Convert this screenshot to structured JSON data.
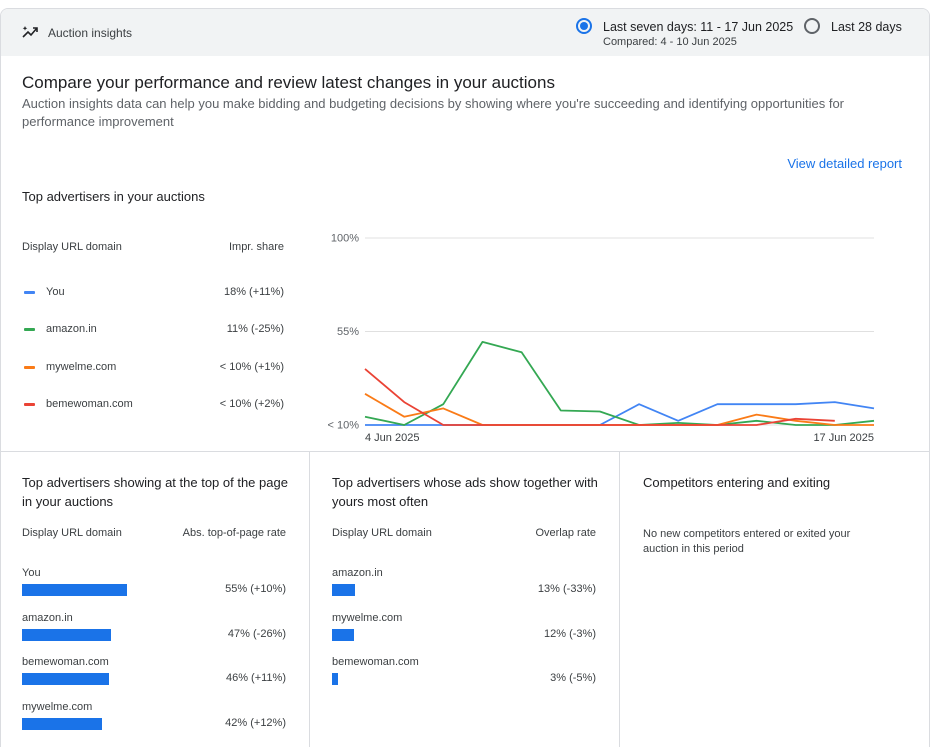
{
  "header": {
    "icon": "trending-up-icon",
    "title": "Auction insights",
    "range_options": [
      {
        "label": "Last seven days: 11 - 17 Jun 2025",
        "sublabel": "Compared: 4 - 10 Jun 2025",
        "selected": true
      },
      {
        "label": "Last 28 days",
        "selected": false
      }
    ]
  },
  "intro": {
    "title": "Compare your performance and review latest changes in your auctions",
    "description": "Auction insights data can help you make bidding and budgeting decisions by showing where you're succeeding and identifying opportunities for performance improvement",
    "view_report": "View detailed report"
  },
  "top_advertisers": {
    "title": "Top advertisers in your auctions",
    "col_domain": "Display URL domain",
    "col_share": "Impr. share",
    "rows": [
      {
        "name": "You",
        "value": "18% (+11%)",
        "color": "#4285f4"
      },
      {
        "name": "amazon.in",
        "value": "11% (-25%)",
        "color": "#34a853"
      },
      {
        "name": "mywelme.com",
        "value": "< 10% (+1%)",
        "color": "#fa7b17"
      },
      {
        "name": "bemewoman.com",
        "value": "< 10% (+2%)",
        "color": "#ea4335"
      }
    ]
  },
  "chart_data": {
    "type": "line",
    "y_tick_labels": [
      "100%",
      "55%",
      "< 10%"
    ],
    "y_ticks": [
      100,
      55,
      10
    ],
    "ylim": [
      10,
      100
    ],
    "x_start_label": "4 Jun 2025",
    "x_end_label": "17 Jun 2025",
    "x": [
      "4 Jun",
      "",
      "",
      "",
      "",
      "",
      "",
      "",
      "",
      "",
      "",
      "",
      "",
      "17 Jun"
    ],
    "grid": true,
    "series": [
      {
        "name": "You",
        "color": "#4285f4",
        "values": [
          10,
          10,
          10,
          10,
          10,
          10,
          10,
          20,
          12,
          20,
          20,
          20,
          21,
          18
        ]
      },
      {
        "name": "amazon.in",
        "color": "#34a853",
        "values": [
          14,
          10,
          20,
          50,
          45,
          17,
          16.5,
          10,
          11,
          10,
          12,
          10,
          10,
          12
        ]
      },
      {
        "name": "mywelme.com",
        "color": "#fa7b17",
        "values": [
          25,
          14,
          18,
          10,
          10,
          10,
          10,
          10,
          10,
          10,
          15,
          12,
          10,
          10
        ]
      },
      {
        "name": "bemewoman.com",
        "color": "#ea4335",
        "values": [
          37,
          21,
          10,
          10,
          10,
          10,
          10,
          10,
          10,
          10,
          10,
          13,
          12,
          null
        ]
      }
    ]
  },
  "top_of_page": {
    "title": "Top advertisers showing at the top of the page in your auctions",
    "col_domain": "Display URL domain",
    "col_rate": "Abs. top-of-page rate",
    "rows": [
      {
        "name": "You",
        "value": "55% (+10%)",
        "fraction": 0.55
      },
      {
        "name": "amazon.in",
        "value": "47% (-26%)",
        "fraction": 0.47
      },
      {
        "name": "bemewoman.com",
        "value": "46% (+11%)",
        "fraction": 0.46
      },
      {
        "name": "mywelme.com",
        "value": "42% (+12%)",
        "fraction": 0.42
      }
    ]
  },
  "overlap": {
    "title": "Top advertisers whose ads show together with yours most often",
    "col_domain": "Display URL domain",
    "col_rate": "Overlap rate",
    "rows": [
      {
        "name": "amazon.in",
        "value": "13% (-33%)",
        "fraction": 0.13
      },
      {
        "name": "mywelme.com",
        "value": "12% (-3%)",
        "fraction": 0.12
      },
      {
        "name": "bemewoman.com",
        "value": "3% (-5%)",
        "fraction": 0.03
      }
    ]
  },
  "competitors": {
    "title": "Competitors entering and exiting",
    "message": "No new competitors entered or exited your auction in this period"
  }
}
